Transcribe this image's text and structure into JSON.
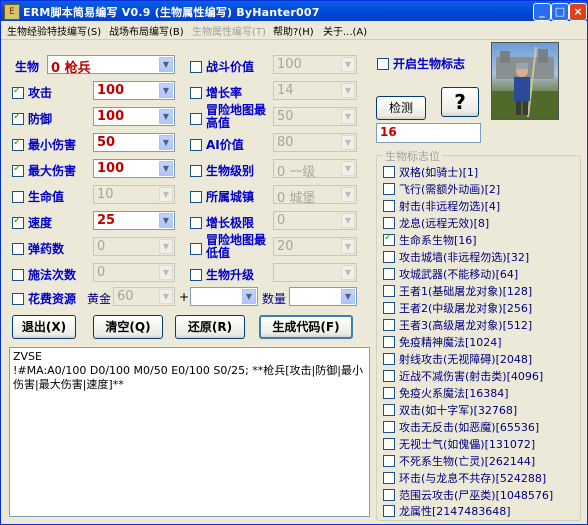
{
  "window": {
    "title": "ERM脚本简易编写 V0.9 (生物属性编写) ByHanter007",
    "min": "_",
    "max": "□",
    "close": "×"
  },
  "menu": [
    {
      "label": "生物经验特技编写(S)",
      "enabled": true
    },
    {
      "label": "战场布局编写(B)",
      "enabled": true
    },
    {
      "label": "生物属性编写(T)",
      "enabled": false
    },
    {
      "label": "帮助?(H)",
      "enabled": true
    },
    {
      "label": "关于...(A)",
      "enabled": true
    }
  ],
  "left": {
    "creature_label": "生物",
    "creature_value": "0 枪兵",
    "attack_label": "攻击",
    "attack_value": "100",
    "defense_label": "防御",
    "defense_value": "100",
    "min_damage_label": "最小伤害",
    "min_damage_value": "50",
    "max_damage_label": "最大伤害",
    "max_damage_value": "100",
    "hp_label": "生命值",
    "hp_value": "10",
    "speed_label": "速度",
    "speed_value": "25",
    "shots_label": "弹药数",
    "shots_value": "0",
    "casts_label": "施法次数",
    "casts_value": "0"
  },
  "middle": {
    "fight_value_label": "战斗价值",
    "fight_value": "100",
    "growth_label": "增长率",
    "growth_value": "14",
    "adv_max_label": "冒险地图最高值",
    "adv_max_value": "50",
    "ai_value_label": "AI价值",
    "ai_value": "80",
    "level_label": "生物级别",
    "level_value": "0 一级",
    "town_label": "所属城镇",
    "town_value": "0 城堡",
    "growth_limit_label": "增长极限",
    "growth_limit_value": "0",
    "adv_min_label": "冒险地图最低值",
    "adv_min_value": "20",
    "upgrade_label": "生物升级",
    "upgrade_value": ""
  },
  "resources": {
    "label": "花费资源",
    "type_label": "黄金",
    "type_value": "60",
    "plus": "+",
    "amount_label": "数量"
  },
  "buttons": {
    "exit": "退出(X)",
    "clear": "清空(Q)",
    "restore": "还原(R)",
    "generate": "生成代码(F)",
    "detect": "检测",
    "help": "?"
  },
  "right": {
    "enable_flags_label": "开启生物标志",
    "flags_output": "16",
    "flags_group_title": "生物标志位"
  },
  "editor": {
    "lines": [
      "ZVSE",
      "!#MA:A0/100 D0/100 M0/50 E0/100 S0/25; **枪兵[攻击|防御|最小伤害|最大伤害|速度]**"
    ]
  },
  "flags": [
    {
      "label": "双格(如骑士)[1]",
      "checked": false
    },
    {
      "label": "飞行(需额外动画)[2]",
      "checked": false
    },
    {
      "label": "射击(非远程勿选)[4]",
      "checked": false
    },
    {
      "label": "龙息(远程无效)[8]",
      "checked": false
    },
    {
      "label": "生命系生物[16]",
      "checked": true
    },
    {
      "label": "攻击城墙(非远程勿选)[32]",
      "checked": false
    },
    {
      "label": "攻城武器(不能移动)[64]",
      "checked": false
    },
    {
      "label": "王者1(基础屠龙对象)[128]",
      "checked": false
    },
    {
      "label": "王者2(中级屠龙对象)[256]",
      "checked": false
    },
    {
      "label": "王者3(高级屠龙对象)[512]",
      "checked": false
    },
    {
      "label": "免疫精神魔法[1024]",
      "checked": false
    },
    {
      "label": "射线攻击(无视障碍)[2048]",
      "checked": false
    },
    {
      "label": "近战不减伤害(射击类)[4096]",
      "checked": false
    },
    {
      "label": "免疫火系魔法[16384]",
      "checked": false
    },
    {
      "label": "双击(如十字军)[32768]",
      "checked": false
    },
    {
      "label": "攻击无反击(如恶魔)[65536]",
      "checked": false
    },
    {
      "label": "无视士气(如傀儡)[131072]",
      "checked": false
    },
    {
      "label": "不死系生物(亡灵)[262144]",
      "checked": false
    },
    {
      "label": "环击(与龙息不共存)[524288]",
      "checked": false
    },
    {
      "label": "范围云攻击(尸巫类)[1048576]",
      "checked": false
    },
    {
      "label": "龙属性[2147483648]",
      "checked": false
    }
  ],
  "colors": {
    "label_blue": "#0000c8",
    "value_red": "#c00000",
    "title_bar": "#0046D5"
  }
}
